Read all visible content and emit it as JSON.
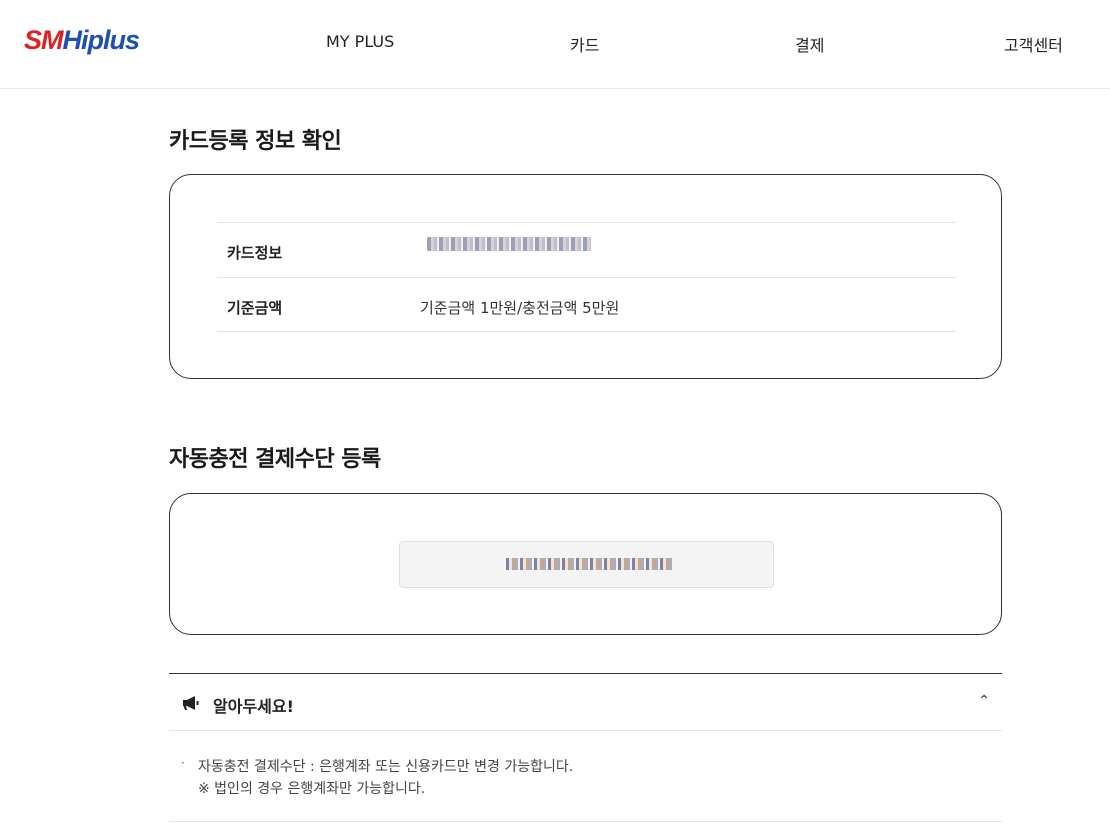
{
  "header": {
    "logo_sm": "SM",
    "logo_hi": "Hiplus",
    "nav": [
      "MY PLUS",
      "카드",
      "결제",
      "고객센터"
    ]
  },
  "card_info": {
    "title": "카드등록 정보 확인",
    "rows": [
      {
        "label": "카드정보",
        "value": ""
      },
      {
        "label": "기준금액",
        "value": "기준금액 1만원/충전금액 5만원"
      }
    ]
  },
  "payment": {
    "title": "자동충전 결제수단 등록"
  },
  "notice": {
    "title": "알아두세요!",
    "bullet": "·",
    "line1": "자동충전 결제수단 : 은행계좌 또는 신용카드만 변경 가능합니다.",
    "line2": "※ 법인의 경우 은행계좌만 가능합니다.",
    "chevron": "⌃"
  },
  "colors": {
    "logo_red": "#e02020",
    "logo_blue": "#1f4fb5"
  },
  "icons": {
    "notice": "megaphone-icon",
    "toggle": "chevron-up-icon"
  }
}
